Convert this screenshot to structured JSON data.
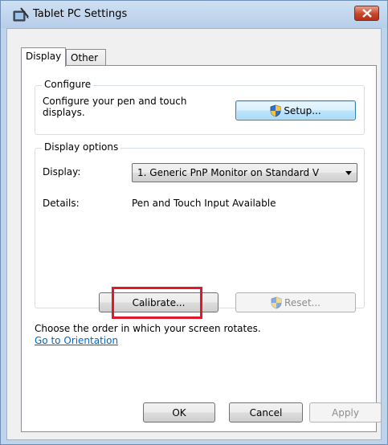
{
  "window": {
    "title": "Tablet PC Settings",
    "close_icon": "close-icon",
    "accent_close": "#c8452b"
  },
  "tabs": [
    {
      "label": "Display",
      "active": true
    },
    {
      "label": "Other",
      "active": false
    }
  ],
  "configure": {
    "group_title": "Configure",
    "description_line1": "Configure your pen and touch",
    "description_line2": "displays.",
    "setup_label": "Setup...",
    "setup_icon": "uac-shield-icon"
  },
  "display_options": {
    "group_title": "Display options",
    "display_label": "Display:",
    "display_value": "1. Generic PnP Monitor on Standard V",
    "details_label": "Details:",
    "details_value": "Pen and Touch Input Available",
    "calibrate_label": "Calibrate...",
    "reset_label": "Reset...",
    "reset_icon": "uac-shield-icon",
    "highlight_color": "#e0192a"
  },
  "orientation": {
    "text": "Choose the order in which your screen rotates.",
    "link": "Go to Orientation"
  },
  "footer": {
    "ok_label": "OK",
    "cancel_label": "Cancel",
    "apply_label": "Apply"
  }
}
